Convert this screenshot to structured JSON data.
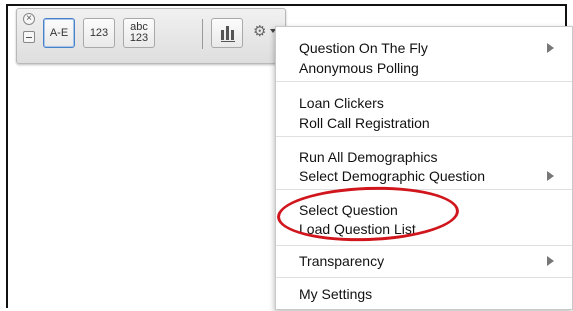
{
  "toolbar": {
    "close_glyph": "×",
    "buttons": [
      {
        "label": "A-E"
      },
      {
        "label": "123"
      },
      {
        "line1": "abc",
        "line2": "123"
      }
    ],
    "chart_icon": "bar-chart-icon",
    "gear_icon": "gear-icon",
    "gear_glyph": "⚙"
  },
  "menu": {
    "groups": [
      {
        "items": [
          {
            "label": "Question On The Fly",
            "submenu": true
          },
          {
            "label": "Anonymous Polling",
            "submenu": false
          }
        ]
      },
      {
        "items": [
          {
            "label": "Loan Clickers",
            "submenu": false
          },
          {
            "label": "Roll Call Registration",
            "submenu": false
          }
        ]
      },
      {
        "items": [
          {
            "label": "Run All Demographics",
            "submenu": false
          },
          {
            "label": "Select Demographic Question",
            "submenu": true
          }
        ]
      },
      {
        "items": [
          {
            "label": "Select Question",
            "submenu": false
          },
          {
            "label": "Load Question List",
            "submenu": false
          }
        ]
      },
      {
        "items": [
          {
            "label": "Transparency",
            "submenu": true
          }
        ]
      },
      {
        "items": [
          {
            "label": "My Settings",
            "submenu": false
          }
        ]
      }
    ]
  },
  "annotation": {
    "color": "#d0161c"
  }
}
